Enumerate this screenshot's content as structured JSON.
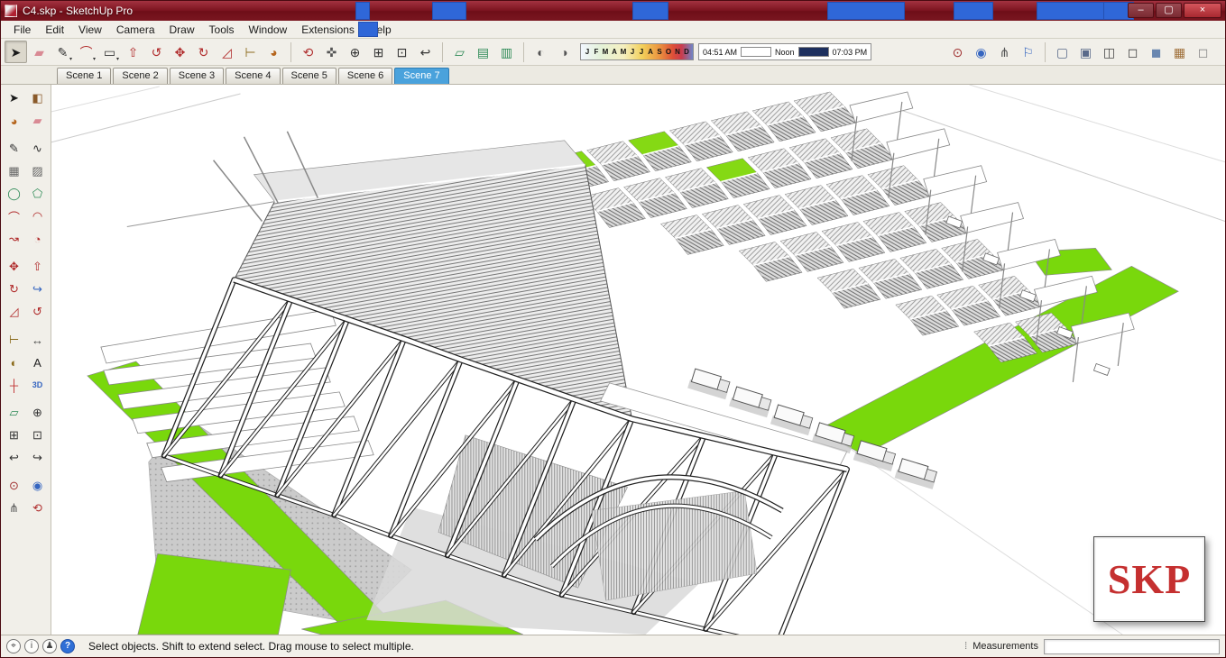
{
  "window": {
    "title": "C4.skp - SketchUp Pro",
    "minimize": "–",
    "maximize": "▢",
    "close": "×"
  },
  "menu": {
    "items": [
      "File",
      "Edit",
      "View",
      "Camera",
      "Draw",
      "Tools",
      "Window",
      "Extensions",
      "Help"
    ]
  },
  "toolbar": {
    "groups": {
      "main": [
        {
          "name": "select-tool",
          "glyph": "➤",
          "color": "#1a1a1a",
          "pressed": true
        },
        {
          "name": "eraser-tool",
          "glyph": "▰",
          "color": "#d98a94"
        },
        {
          "name": "line-tool",
          "glyph": "✎",
          "color": "#333333",
          "dropdown": true
        },
        {
          "name": "arc-tool",
          "glyph": "⌒",
          "color": "#b02a2a",
          "dropdown": true
        },
        {
          "name": "shape-tool",
          "glyph": "▭",
          "color": "#333333",
          "dropdown": true
        },
        {
          "name": "push-pull-tool",
          "glyph": "⇧",
          "color": "#b02a2a"
        },
        {
          "name": "offset-tool",
          "glyph": "↺",
          "color": "#b02a2a"
        },
        {
          "name": "move-tool",
          "glyph": "✥",
          "color": "#b02a2a"
        },
        {
          "name": "rotate-tool",
          "glyph": "↻",
          "color": "#b02a2a"
        },
        {
          "name": "scale-tool",
          "glyph": "◿",
          "color": "#b02a2a"
        },
        {
          "name": "tape-measure-tool",
          "glyph": "⊢",
          "color": "#8a6a1a"
        },
        {
          "name": "paint-bucket-tool",
          "glyph": "◕",
          "color": "#b5651d"
        }
      ],
      "camera": [
        {
          "name": "orbit-tool",
          "glyph": "⟲",
          "color": "#b03030"
        },
        {
          "name": "pan-tool",
          "glyph": "✜",
          "color": "#555555"
        },
        {
          "name": "zoom-tool",
          "glyph": "⊕",
          "color": "#333333"
        },
        {
          "name": "zoom-window-tool",
          "glyph": "⊞",
          "color": "#333333"
        },
        {
          "name": "zoom-extents-tool",
          "glyph": "⊡",
          "color": "#333333"
        },
        {
          "name": "previous-view",
          "glyph": "↩",
          "color": "#333333"
        }
      ],
      "section": [
        {
          "name": "section-plane-tool",
          "glyph": "▱",
          "color": "#2e8b57"
        },
        {
          "name": "display-section-planes",
          "glyph": "▤",
          "color": "#2e8b57"
        },
        {
          "name": "display-section-cuts",
          "glyph": "▥",
          "color": "#2e8b57"
        }
      ],
      "shadow": [
        {
          "name": "shadow-settings",
          "glyph": "◐",
          "color": "#555555"
        },
        {
          "name": "toggle-shadows",
          "glyph": "◑",
          "color": "#555555"
        }
      ],
      "tour": [
        {
          "name": "position-camera-tool",
          "glyph": "⊙",
          "color": "#a03030"
        },
        {
          "name": "look-around-tool",
          "glyph": "◉",
          "color": "#3565c0"
        },
        {
          "name": "walk-tool",
          "glyph": "⋔",
          "color": "#555555"
        },
        {
          "name": "add-location",
          "glyph": "⚐",
          "color": "#3565c0"
        }
      ],
      "styles": [
        {
          "name": "style-x-ray",
          "glyph": "▢",
          "color": "#5a6a8a"
        },
        {
          "name": "style-back-edges",
          "glyph": "▣",
          "color": "#5a6a8a"
        },
        {
          "name": "style-wireframe",
          "glyph": "◫",
          "color": "#444444"
        },
        {
          "name": "style-hidden-line",
          "glyph": "◻",
          "color": "#444444"
        },
        {
          "name": "style-shaded",
          "glyph": "◼",
          "color": "#6a87b0"
        },
        {
          "name": "style-shaded-textures",
          "glyph": "▦",
          "color": "#a0703a"
        },
        {
          "name": "style-monochrome",
          "glyph": "◻",
          "color": "#888888"
        }
      ]
    },
    "shadows": {
      "months": [
        "J",
        "F",
        "M",
        "A",
        "M",
        "J",
        "J",
        "A",
        "S",
        "O",
        "N",
        "D"
      ],
      "time_start": "04:51 AM",
      "time_noon": "Noon",
      "time_end": "07:03 PM"
    }
  },
  "scene_tabs": [
    {
      "label": "Scene 1",
      "active": false
    },
    {
      "label": "Scene 2",
      "active": false
    },
    {
      "label": "Scene 3",
      "active": false
    },
    {
      "label": "Scene 4",
      "active": false
    },
    {
      "label": "Scene 5",
      "active": false
    },
    {
      "label": "Scene 6",
      "active": false
    },
    {
      "label": "Scene 7",
      "active": true
    }
  ],
  "palette": {
    "group_breaks": [
      1,
      6,
      9,
      12,
      15
    ],
    "rows": [
      [
        {
          "name": "select",
          "glyph": "➤",
          "color": "#1a1a1a"
        },
        {
          "name": "make-component",
          "glyph": "◧",
          "color": "#8a5a2a"
        }
      ],
      [
        {
          "name": "paint-bucket",
          "glyph": "◕",
          "color": "#b5651d"
        },
        {
          "name": "eraser",
          "glyph": "▰",
          "color": "#d98a94"
        }
      ],
      [
        {
          "name": "line",
          "glyph": "✎",
          "color": "#333333"
        },
        {
          "name": "freehand",
          "glyph": "∿",
          "color": "#333333"
        }
      ],
      [
        {
          "name": "rectangle",
          "glyph": "▦",
          "color": "#666666"
        },
        {
          "name": "rotated-rectangle",
          "glyph": "▨",
          "color": "#666666"
        }
      ],
      [
        {
          "name": "circle",
          "glyph": "◯",
          "color": "#2e8b57"
        },
        {
          "name": "polygon",
          "glyph": "⬠",
          "color": "#2e8b57"
        }
      ],
      [
        {
          "name": "arc",
          "glyph": "⌒",
          "color": "#b02a2a"
        },
        {
          "name": "two-point-arc",
          "glyph": "◠",
          "color": "#b02a2a"
        }
      ],
      [
        {
          "name": "three-point-arc",
          "glyph": "↝",
          "color": "#b02a2a"
        },
        {
          "name": "pie",
          "glyph": "◔",
          "color": "#b02a2a"
        }
      ],
      [
        {
          "name": "move",
          "glyph": "✥",
          "color": "#b02a2a"
        },
        {
          "name": "push-pull",
          "glyph": "⇧",
          "color": "#b02a2a"
        }
      ],
      [
        {
          "name": "rotate",
          "glyph": "↻",
          "color": "#b02a2a"
        },
        {
          "name": "follow-me",
          "glyph": "↪",
          "color": "#3565c0"
        }
      ],
      [
        {
          "name": "scale",
          "glyph": "◿",
          "color": "#b02a2a"
        },
        {
          "name": "offset",
          "glyph": "↺",
          "color": "#b02a2a"
        }
      ],
      [
        {
          "name": "tape-measure",
          "glyph": "⊢",
          "color": "#8a6a1a"
        },
        {
          "name": "dimensions",
          "glyph": "↔",
          "color": "#444444"
        }
      ],
      [
        {
          "name": "protractor",
          "glyph": "◐",
          "color": "#8a6a1a"
        },
        {
          "name": "text",
          "glyph": "A",
          "color": "#222222"
        }
      ],
      [
        {
          "name": "axes",
          "glyph": "┼",
          "color": "#c03030"
        },
        {
          "name": "three-d-text",
          "glyph": "3D",
          "color": "#3565c0"
        }
      ],
      [
        {
          "name": "section-plane",
          "glyph": "▱",
          "color": "#2e8b57"
        },
        {
          "name": "zoom",
          "glyph": "⊕",
          "color": "#333333"
        }
      ],
      [
        {
          "name": "zoom-window",
          "glyph": "⊞",
          "color": "#333333"
        },
        {
          "name": "zoom-extents",
          "glyph": "⊡",
          "color": "#333333"
        }
      ],
      [
        {
          "name": "previous-view",
          "glyph": "↩",
          "color": "#333333"
        },
        {
          "name": "next-view",
          "glyph": "↪",
          "color": "#333333"
        }
      ],
      [
        {
          "name": "position-camera",
          "glyph": "⊙",
          "color": "#a03030"
        },
        {
          "name": "look-around",
          "glyph": "◉",
          "color": "#3565c0"
        }
      ],
      [
        {
          "name": "walk",
          "glyph": "⋔",
          "color": "#555555"
        },
        {
          "name": "orbit",
          "glyph": "⟲",
          "color": "#b03030"
        }
      ]
    ]
  },
  "viewport": {
    "logo_text": "SKP"
  },
  "statusbar": {
    "icons": [
      {
        "name": "geolocation-icon",
        "glyph": "⌖"
      },
      {
        "name": "credits-icon",
        "glyph": "i"
      },
      {
        "name": "sign-in-icon",
        "glyph": "♟"
      },
      {
        "name": "help-icon",
        "glyph": "?"
      }
    ],
    "hint": "Select objects. Shift to extend select. Drag mouse to select multiple.",
    "measurements_label": "Measurements"
  }
}
